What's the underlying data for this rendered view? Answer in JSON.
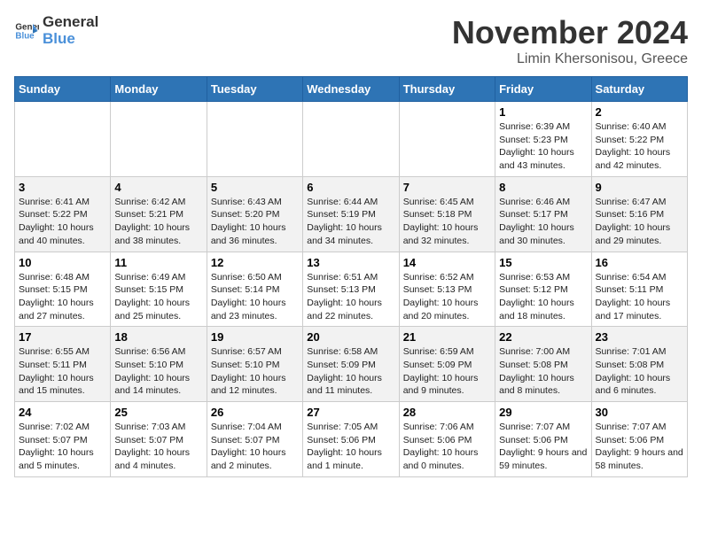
{
  "header": {
    "logo_general": "General",
    "logo_blue": "Blue",
    "month": "November 2024",
    "location": "Limin Khersonisou, Greece"
  },
  "weekdays": [
    "Sunday",
    "Monday",
    "Tuesday",
    "Wednesday",
    "Thursday",
    "Friday",
    "Saturday"
  ],
  "weeks": [
    [
      {
        "day": "",
        "info": ""
      },
      {
        "day": "",
        "info": ""
      },
      {
        "day": "",
        "info": ""
      },
      {
        "day": "",
        "info": ""
      },
      {
        "day": "",
        "info": ""
      },
      {
        "day": "1",
        "info": "Sunrise: 6:39 AM\nSunset: 5:23 PM\nDaylight: 10 hours and 43 minutes."
      },
      {
        "day": "2",
        "info": "Sunrise: 6:40 AM\nSunset: 5:22 PM\nDaylight: 10 hours and 42 minutes."
      }
    ],
    [
      {
        "day": "3",
        "info": "Sunrise: 6:41 AM\nSunset: 5:22 PM\nDaylight: 10 hours and 40 minutes."
      },
      {
        "day": "4",
        "info": "Sunrise: 6:42 AM\nSunset: 5:21 PM\nDaylight: 10 hours and 38 minutes."
      },
      {
        "day": "5",
        "info": "Sunrise: 6:43 AM\nSunset: 5:20 PM\nDaylight: 10 hours and 36 minutes."
      },
      {
        "day": "6",
        "info": "Sunrise: 6:44 AM\nSunset: 5:19 PM\nDaylight: 10 hours and 34 minutes."
      },
      {
        "day": "7",
        "info": "Sunrise: 6:45 AM\nSunset: 5:18 PM\nDaylight: 10 hours and 32 minutes."
      },
      {
        "day": "8",
        "info": "Sunrise: 6:46 AM\nSunset: 5:17 PM\nDaylight: 10 hours and 30 minutes."
      },
      {
        "day": "9",
        "info": "Sunrise: 6:47 AM\nSunset: 5:16 PM\nDaylight: 10 hours and 29 minutes."
      }
    ],
    [
      {
        "day": "10",
        "info": "Sunrise: 6:48 AM\nSunset: 5:15 PM\nDaylight: 10 hours and 27 minutes."
      },
      {
        "day": "11",
        "info": "Sunrise: 6:49 AM\nSunset: 5:15 PM\nDaylight: 10 hours and 25 minutes."
      },
      {
        "day": "12",
        "info": "Sunrise: 6:50 AM\nSunset: 5:14 PM\nDaylight: 10 hours and 23 minutes."
      },
      {
        "day": "13",
        "info": "Sunrise: 6:51 AM\nSunset: 5:13 PM\nDaylight: 10 hours and 22 minutes."
      },
      {
        "day": "14",
        "info": "Sunrise: 6:52 AM\nSunset: 5:13 PM\nDaylight: 10 hours and 20 minutes."
      },
      {
        "day": "15",
        "info": "Sunrise: 6:53 AM\nSunset: 5:12 PM\nDaylight: 10 hours and 18 minutes."
      },
      {
        "day": "16",
        "info": "Sunrise: 6:54 AM\nSunset: 5:11 PM\nDaylight: 10 hours and 17 minutes."
      }
    ],
    [
      {
        "day": "17",
        "info": "Sunrise: 6:55 AM\nSunset: 5:11 PM\nDaylight: 10 hours and 15 minutes."
      },
      {
        "day": "18",
        "info": "Sunrise: 6:56 AM\nSunset: 5:10 PM\nDaylight: 10 hours and 14 minutes."
      },
      {
        "day": "19",
        "info": "Sunrise: 6:57 AM\nSunset: 5:10 PM\nDaylight: 10 hours and 12 minutes."
      },
      {
        "day": "20",
        "info": "Sunrise: 6:58 AM\nSunset: 5:09 PM\nDaylight: 10 hours and 11 minutes."
      },
      {
        "day": "21",
        "info": "Sunrise: 6:59 AM\nSunset: 5:09 PM\nDaylight: 10 hours and 9 minutes."
      },
      {
        "day": "22",
        "info": "Sunrise: 7:00 AM\nSunset: 5:08 PM\nDaylight: 10 hours and 8 minutes."
      },
      {
        "day": "23",
        "info": "Sunrise: 7:01 AM\nSunset: 5:08 PM\nDaylight: 10 hours and 6 minutes."
      }
    ],
    [
      {
        "day": "24",
        "info": "Sunrise: 7:02 AM\nSunset: 5:07 PM\nDaylight: 10 hours and 5 minutes."
      },
      {
        "day": "25",
        "info": "Sunrise: 7:03 AM\nSunset: 5:07 PM\nDaylight: 10 hours and 4 minutes."
      },
      {
        "day": "26",
        "info": "Sunrise: 7:04 AM\nSunset: 5:07 PM\nDaylight: 10 hours and 2 minutes."
      },
      {
        "day": "27",
        "info": "Sunrise: 7:05 AM\nSunset: 5:06 PM\nDaylight: 10 hours and 1 minute."
      },
      {
        "day": "28",
        "info": "Sunrise: 7:06 AM\nSunset: 5:06 PM\nDaylight: 10 hours and 0 minutes."
      },
      {
        "day": "29",
        "info": "Sunrise: 7:07 AM\nSunset: 5:06 PM\nDaylight: 9 hours and 59 minutes."
      },
      {
        "day": "30",
        "info": "Sunrise: 7:07 AM\nSunset: 5:06 PM\nDaylight: 9 hours and 58 minutes."
      }
    ]
  ]
}
